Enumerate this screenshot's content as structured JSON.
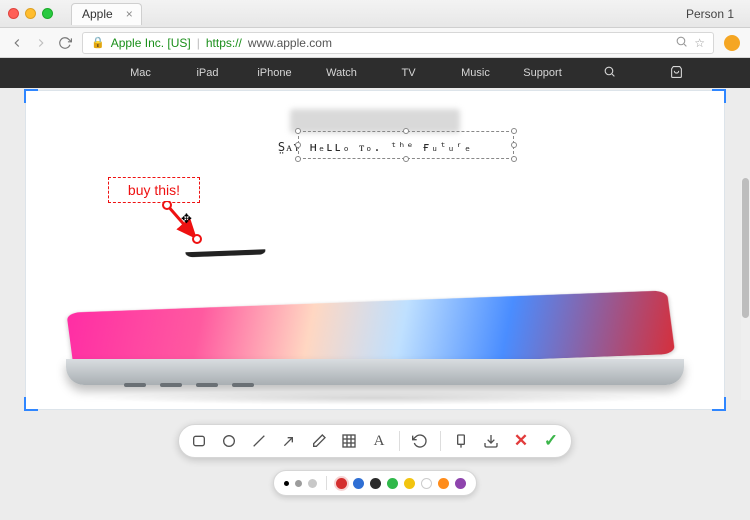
{
  "window": {
    "tab_title": "Apple",
    "user_label": "Person 1"
  },
  "address_bar": {
    "ev_label": "Apple Inc. [US]",
    "scheme": "https://",
    "host_path": "www.apple.com"
  },
  "site_nav": {
    "items": [
      "Mac",
      "iPad",
      "iPhone",
      "Watch",
      "TV",
      "Music",
      "Support"
    ]
  },
  "annotation": {
    "text": "buy this!"
  },
  "blurred": {
    "subtitle_noise": "S̤ᴀʏ ʜₑʟʟₒ ᴛₒ. ᵗʰᵉ ғᵤᵗᵤʳₑ"
  },
  "tools": {
    "rect": "rectangle-tool",
    "ellipse": "ellipse-tool",
    "line": "line-tool",
    "arrow": "arrow-tool",
    "pen": "pen-tool",
    "blur": "blur-tool",
    "text": "text-tool",
    "undo": "undo",
    "pin": "pin-to-screen",
    "save": "save",
    "cancel": "cancel",
    "confirm": "confirm"
  },
  "palette": {
    "stroke_weights": [
      "small",
      "medium",
      "large"
    ],
    "colors": [
      "#d42f2f",
      "#2f6fd4",
      "#2a2a2a",
      "#2fb84a",
      "#f2c40f",
      "#ffffff",
      "#ff8c1a",
      "#8e44ad"
    ],
    "selected_color": "#d42f2f"
  }
}
